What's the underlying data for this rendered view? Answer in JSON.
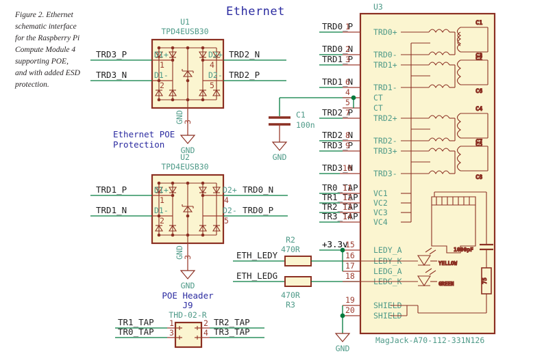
{
  "figure": {
    "caption": "Figure 2. Ethernet schematic interface for the Raspberry Pi Compute Module 4 supporting POE, and with added ESD protection."
  },
  "colors": {
    "wire_green": "#007a3d",
    "wire_red": "#9c3b2e",
    "component_outline": "#8b2f22",
    "component_fill": "#fbf5d0",
    "pin_label": "#4e9a88",
    "title_blue": "#2b2ba0",
    "pin_number": "#9c3b2e",
    "gnd_label": "#4e9a88",
    "background": "#ffffff"
  },
  "titles": {
    "ethernet": "Ethernet",
    "poe_protection_line1": "Ethernet POE",
    "poe_protection_line2": "Protection",
    "poe_header": "POE Header"
  },
  "u1": {
    "ref": "U1",
    "value": "TPD4EUSB30",
    "left_nets": [
      "TRD3_P",
      "TRD3_N"
    ],
    "right_nets": [
      "TRD2_N",
      "TRD2_P"
    ],
    "left_pin_names": [
      "D1+",
      "D1-"
    ],
    "right_pin_names": [
      "D2+",
      "D2-"
    ],
    "left_pin_numbers": [
      "1",
      "2"
    ],
    "right_pin_numbers": [
      "4",
      "5"
    ],
    "gnd_pin_name": "GND",
    "gnd_pin_number": "3",
    "gnd_label": "GND"
  },
  "u2": {
    "ref": "U2",
    "value": "TPD4EUSB30",
    "left_nets": [
      "TRD1_P",
      "TRD1_N"
    ],
    "right_nets": [
      "TRD0_N",
      "TRD0_P"
    ],
    "left_pin_names": [
      "D1+",
      "D1-"
    ],
    "right_pin_names": [
      "D2+",
      "D2-"
    ],
    "left_pin_numbers": [
      "1",
      "2"
    ],
    "right_pin_numbers": [
      "4",
      "5"
    ],
    "gnd_pin_name": "GND",
    "gnd_pin_number": "3",
    "gnd_label": "GND"
  },
  "c1": {
    "ref": "C1",
    "value": "100n",
    "gnd_label": "GND"
  },
  "r2": {
    "ref": "R2",
    "value": "470R",
    "net": "ETH_LEDY"
  },
  "r3": {
    "ref": "R3",
    "value": "470R",
    "net": "ETH_LEDG"
  },
  "j9": {
    "ref": "J9",
    "value": "THD-02-R",
    "title": "POE Header",
    "pins": [
      {
        "number": "1",
        "net": "TR1_TAP",
        "side": "left"
      },
      {
        "number": "3",
        "net": "TR0_TAP",
        "side": "left"
      },
      {
        "number": "2",
        "net": "TR2_TAP",
        "side": "right"
      },
      {
        "number": "4",
        "net": "TR3_TAP",
        "side": "right"
      }
    ]
  },
  "u3": {
    "ref": "U3",
    "value": "MagJack-A70-112-331N126",
    "pins": [
      {
        "number": "1",
        "name": "TRD0+",
        "net": "TRD0_P"
      },
      {
        "number": "2",
        "name": "TRD0-",
        "net": "TRD0_N"
      },
      {
        "number": "3",
        "name": "TRD1+",
        "net": "TRD1_P"
      },
      {
        "number": "6",
        "name": "TRD1-",
        "net": "TRD1_N"
      },
      {
        "number": "4",
        "name": "CT",
        "net": ""
      },
      {
        "number": "5",
        "name": "CT",
        "net": ""
      },
      {
        "number": "7",
        "name": "TRD2+",
        "net": "TRD2_P"
      },
      {
        "number": "8",
        "name": "TRD2-",
        "net": "TRD2_N"
      },
      {
        "number": "9",
        "name": "TRD3+",
        "net": "TRD3_P"
      },
      {
        "number": "10",
        "name": "TRD3-",
        "net": "TRD3_N"
      },
      {
        "number": "11",
        "name": "VC1",
        "net": "TR0_TAP"
      },
      {
        "number": "12",
        "name": "VC2",
        "net": "TR1_TAP"
      },
      {
        "number": "13",
        "name": "VC3",
        "net": "TR2_TAP"
      },
      {
        "number": "14",
        "name": "VC4",
        "net": "TR3_TAP"
      },
      {
        "number": "15",
        "name": "LEDY_A",
        "net": "+3.3v"
      },
      {
        "number": "16",
        "name": "LEDY_K",
        "net": ""
      },
      {
        "number": "17",
        "name": "LEDG_A",
        "net": ""
      },
      {
        "number": "18",
        "name": "LEDG_K",
        "net": ""
      },
      {
        "number": "19",
        "name": "SHIELD",
        "net": ""
      },
      {
        "number": "20",
        "name": "SHIELD",
        "net": ""
      }
    ],
    "coil_labels": [
      "C1",
      "C2",
      "C3",
      "C6",
      "C4",
      "C5",
      "C7",
      "C8"
    ],
    "led_labels": [
      "YELLOW",
      "GREEN"
    ],
    "bob_smith_cap": "1000pF",
    "bob_smith_res": "75",
    "gnd_label": "GND"
  },
  "power": {
    "plus_3v3": "+3.3v"
  }
}
